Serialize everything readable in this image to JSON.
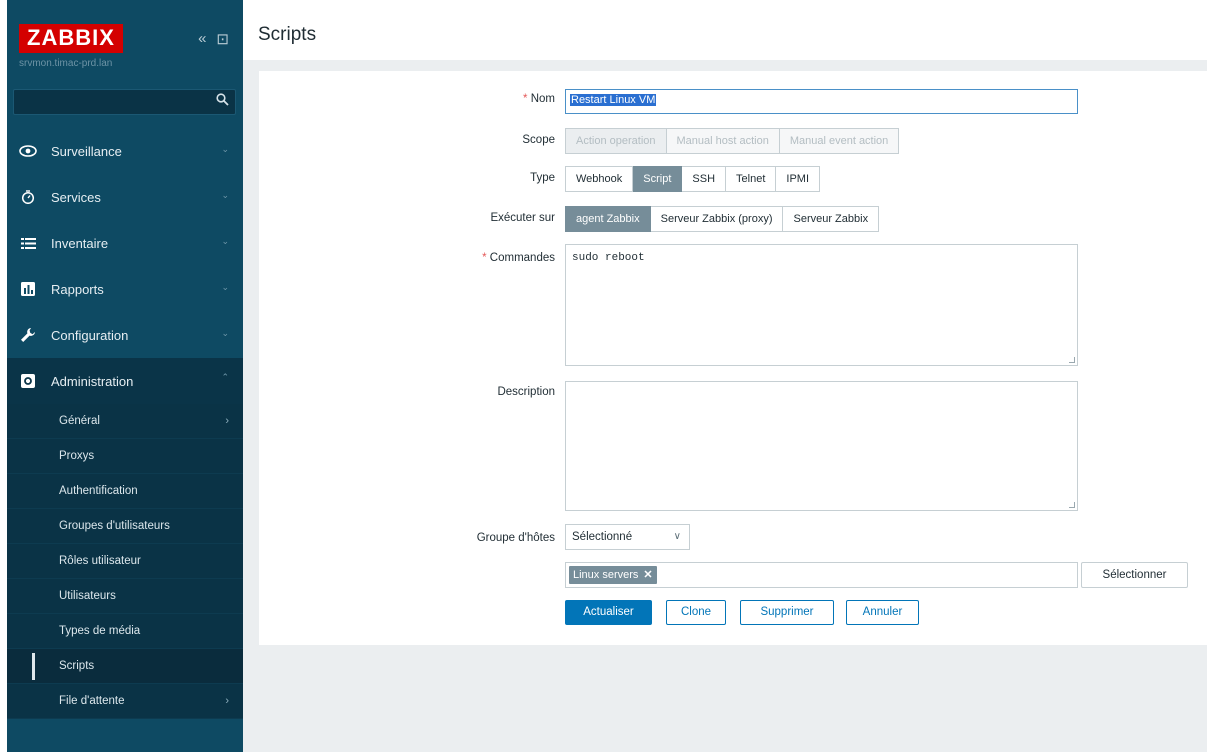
{
  "sidebar": {
    "logo": "ZABBIX",
    "server": "srvmon.timac-prd.lan",
    "collapse_icon": "«",
    "kiosk_icon": "⊡",
    "search_placeholder": "",
    "menu": [
      {
        "label": "Surveillance",
        "icon": "eye-icon"
      },
      {
        "label": "Services",
        "icon": "clock-icon"
      },
      {
        "label": "Inventaire",
        "icon": "list-icon"
      },
      {
        "label": "Rapports",
        "icon": "chart-icon"
      },
      {
        "label": "Configuration",
        "icon": "wrench-icon"
      },
      {
        "label": "Administration",
        "icon": "gear-icon"
      }
    ],
    "submenu": [
      {
        "label": "Général",
        "has_children": true
      },
      {
        "label": "Proxys"
      },
      {
        "label": "Authentification"
      },
      {
        "label": "Groupes d'utilisateurs"
      },
      {
        "label": "Rôles utilisateur"
      },
      {
        "label": "Utilisateurs"
      },
      {
        "label": "Types de média"
      },
      {
        "label": "Scripts",
        "current": true
      },
      {
        "label": "File d'attente",
        "has_children": true
      }
    ]
  },
  "page": {
    "title": "Scripts"
  },
  "form": {
    "name": {
      "label": "Nom",
      "value": "Restart Linux VM"
    },
    "scope": {
      "label": "Scope",
      "options": [
        "Action operation",
        "Manual host action",
        "Manual event action"
      ],
      "selected": "Action operation"
    },
    "type": {
      "label": "Type",
      "options": [
        "Webhook",
        "Script",
        "SSH",
        "Telnet",
        "IPMI"
      ],
      "selected": "Script"
    },
    "execute_on": {
      "label": "Exécuter sur",
      "options": [
        "agent Zabbix",
        "Serveur Zabbix (proxy)",
        "Serveur Zabbix"
      ],
      "selected": "agent Zabbix"
    },
    "commands": {
      "label": "Commandes",
      "value": "sudo reboot"
    },
    "description": {
      "label": "Description",
      "value": ""
    },
    "host_group": {
      "label": "Groupe d'hôtes",
      "selected": "Sélectionné",
      "chip": "Linux servers",
      "select_button": "Sélectionner"
    },
    "buttons": {
      "update": "Actualiser",
      "clone": "Clone",
      "delete": "Supprimer",
      "cancel": "Annuler"
    }
  }
}
